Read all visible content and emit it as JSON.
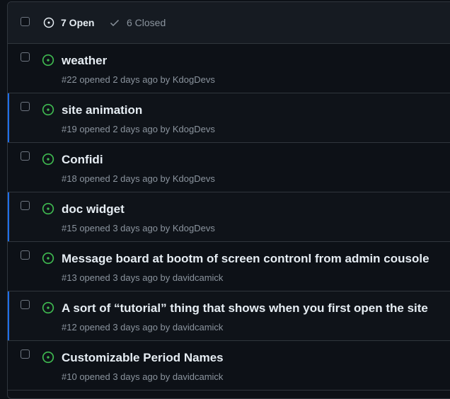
{
  "header": {
    "open_label": "7 Open",
    "closed_label": "6 Closed"
  },
  "colors": {
    "open_icon": "#3fb950",
    "accent": "#1f6feb"
  },
  "issues": [
    {
      "title": "weather",
      "number": "#22",
      "opened": "opened 2 days ago by",
      "author": "KdogDevs",
      "highlight": false
    },
    {
      "title": "site animation",
      "number": "#19",
      "opened": "opened 2 days ago by",
      "author": "KdogDevs",
      "highlight": true
    },
    {
      "title": "Confidi",
      "number": "#18",
      "opened": "opened 2 days ago by",
      "author": "KdogDevs",
      "highlight": false
    },
    {
      "title": "doc widget",
      "number": "#15",
      "opened": "opened 3 days ago by",
      "author": "KdogDevs",
      "highlight": true
    },
    {
      "title": "Message board at bootm of screen contronl from admin cousole",
      "number": "#13",
      "opened": "opened 3 days ago by",
      "author": "davidcamick",
      "highlight": false
    },
    {
      "title": "A sort of “tutorial” thing that shows when you first open the site",
      "number": "#12",
      "opened": "opened 3 days ago by",
      "author": "davidcamick",
      "highlight": true
    },
    {
      "title": "Customizable Period Names",
      "number": "#10",
      "opened": "opened 3 days ago by",
      "author": "davidcamick",
      "highlight": false
    }
  ]
}
